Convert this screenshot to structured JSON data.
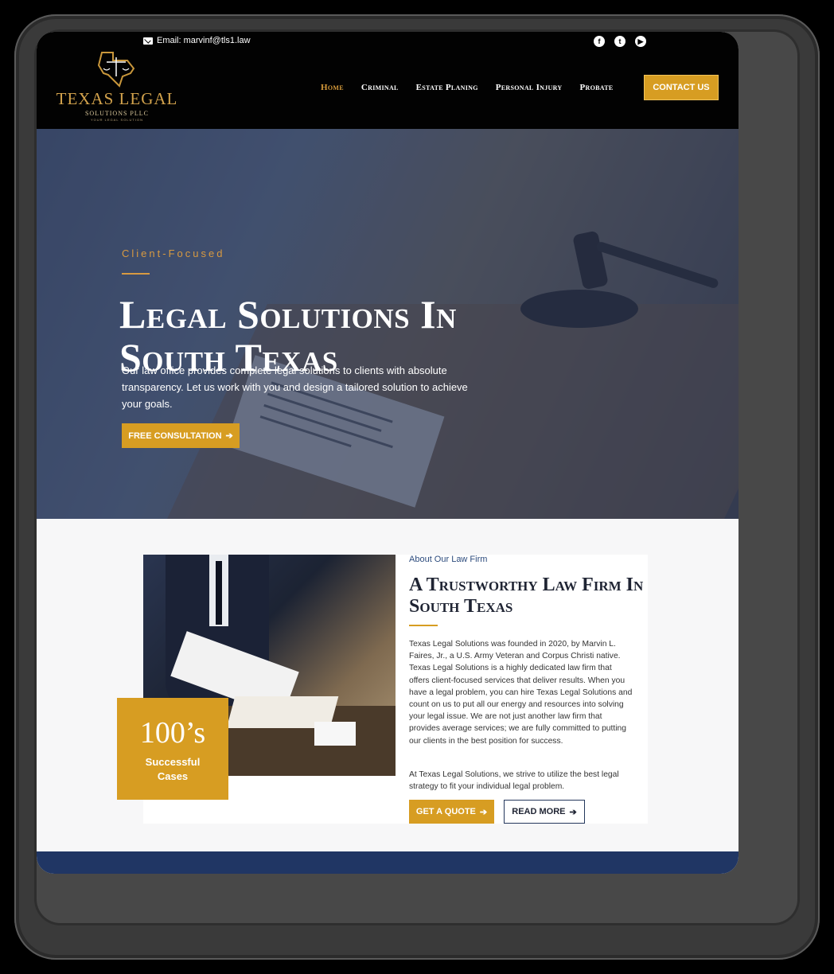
{
  "topbar": {
    "email": "Email: marvinf@tls1.law",
    "social_icons": [
      "facebook-icon",
      "twitter-icon",
      "youtube-icon"
    ]
  },
  "logo": {
    "name": "TEXAS LEGAL",
    "sub": "SOLUTIONS PLLC",
    "tagline": "YOUR LEGAL SOLUTION"
  },
  "nav": {
    "items": [
      "Home",
      "Criminal",
      "Estate Planing",
      "Personal Injury",
      "Probate"
    ],
    "cta": "CONTACT US"
  },
  "hero": {
    "label": "Client-Focused",
    "title": "Legal Solutions In South Texas",
    "text": "Our law office provides complete legal solutions to clients with absolute transparency. Let us work with you and design a tailored solution to achieve your goals.",
    "button": "FREE CONSULTATION"
  },
  "about": {
    "kicker": "About Our Law Firm",
    "title": "A Trustworthy Law Firm In South Texas",
    "p1": "Texas Legal Solutions was founded in 2020, by Marvin L. Faires, Jr., a U.S. Army Veteran and Corpus Christi native. Texas Legal Solutions is a highly dedicated law firm that offers client-focused services that deliver results. When you have a legal problem, you can hire Texas Legal Solutions and count on us to put all our energy and resources into solving your legal issue. We are not just another law firm that provides average services; we are fully committed to putting our clients in the best position for success.",
    "p2": "At Texas Legal Solutions, we strive to utilize the best legal strategy to fit your individual legal problem.",
    "quote_button": "GET A QUOTE",
    "more_button": "READ MORE",
    "stat_number": "100’s",
    "stat_label": "Successful Cases"
  },
  "colors": {
    "gold": "#d79d22",
    "navy": "#203664"
  }
}
